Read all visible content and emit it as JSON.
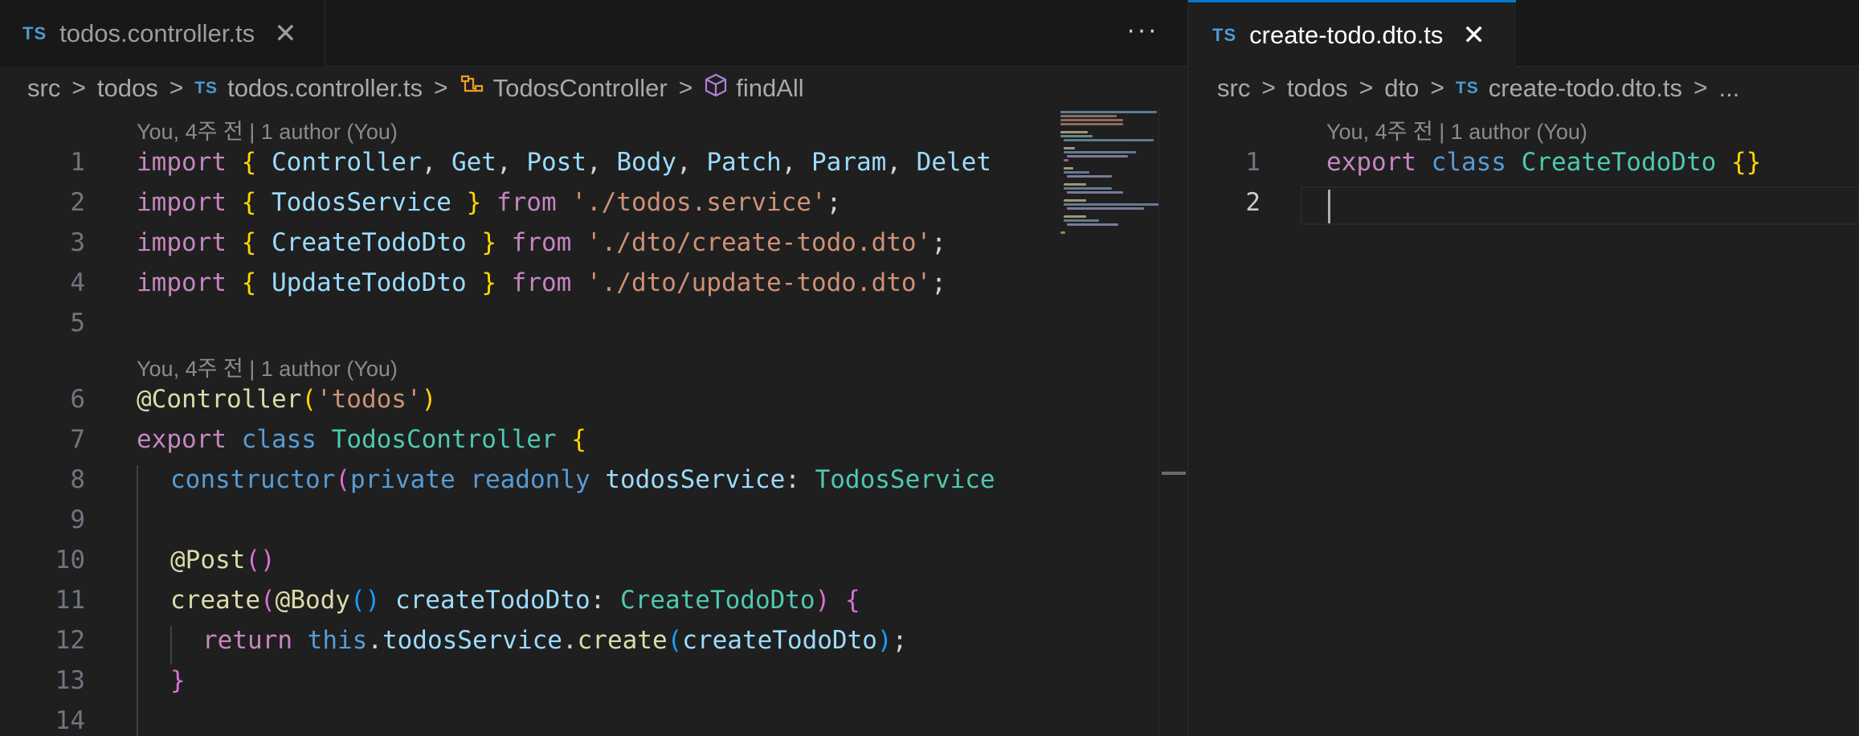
{
  "left_pane": {
    "tab": {
      "badge": "TS",
      "label": "todos.controller.ts",
      "close": "✕"
    },
    "more_actions": "···",
    "breadcrumb": {
      "items": [
        "src",
        "todos",
        "todos.controller.ts",
        "TodosController",
        "findAll"
      ],
      "separator": ">",
      "badge": "TS"
    },
    "codelens": [
      "You, 4주 전 | 1 author (You)",
      "You, 4주 전 | 1 author (You)"
    ],
    "line_numbers": [
      "1",
      "2",
      "3",
      "4",
      "5",
      "6",
      "7",
      "8",
      "9",
      "10",
      "11",
      "12",
      "13",
      "14"
    ]
  },
  "right_pane": {
    "tab": {
      "badge": "TS",
      "label": "create-todo.dto.ts",
      "close": "✕"
    },
    "breadcrumb": {
      "items": [
        "src",
        "todos",
        "dto",
        "create-todo.dto.ts",
        "..."
      ],
      "separator": ">",
      "badge": "TS"
    },
    "codelens": "You, 4주 전 | 1 author (You)",
    "line_numbers": [
      "1",
      "2"
    ]
  },
  "code_tokens": {
    "l1": [
      "import",
      "{",
      "Controller",
      ",",
      "Get",
      ",",
      "Post",
      ",",
      "Body",
      ",",
      "Patch",
      ",",
      "Param",
      ",",
      "Delet"
    ],
    "l2": [
      "import",
      "{",
      "TodosService",
      "}",
      "from",
      "'./todos.service'",
      ";"
    ],
    "l3": [
      "import",
      "{",
      "CreateTodoDto",
      "}",
      "from",
      "'./dto/create-todo.dto'",
      ";"
    ],
    "l4": [
      "import",
      "{",
      "UpdateTodoDto",
      "}",
      "from",
      "'./dto/update-todo.dto'",
      ";"
    ],
    "l6": [
      "@Controller",
      "(",
      "'todos'",
      ")"
    ],
    "l7": [
      "export",
      "class",
      "TodosController",
      "{"
    ],
    "l8": [
      "constructor",
      "(",
      "private",
      "readonly",
      "todosService",
      ":",
      "TodosService"
    ],
    "l10": [
      "@Post",
      "()"
    ],
    "l11": [
      "create",
      "(",
      "@Body",
      "()",
      "createTodoDto",
      ":",
      "CreateTodoDto",
      ")",
      "{"
    ],
    "l12": [
      "return",
      "this",
      ".",
      "todosService",
      ".",
      "create",
      "(",
      "createTodoDto",
      ")",
      ";"
    ],
    "l13": [
      "}"
    ],
    "r1": [
      "export",
      "class",
      "CreateTodoDto",
      "{}"
    ]
  },
  "colors": {
    "keyword_pink": "#c586c0",
    "keyword_blue": "#569cd6",
    "identifier": "#9cdcfe",
    "type": "#4ec9b0",
    "string": "#ce9178",
    "function": "#dcdcaa",
    "active_tab_border": "#0078d4"
  }
}
